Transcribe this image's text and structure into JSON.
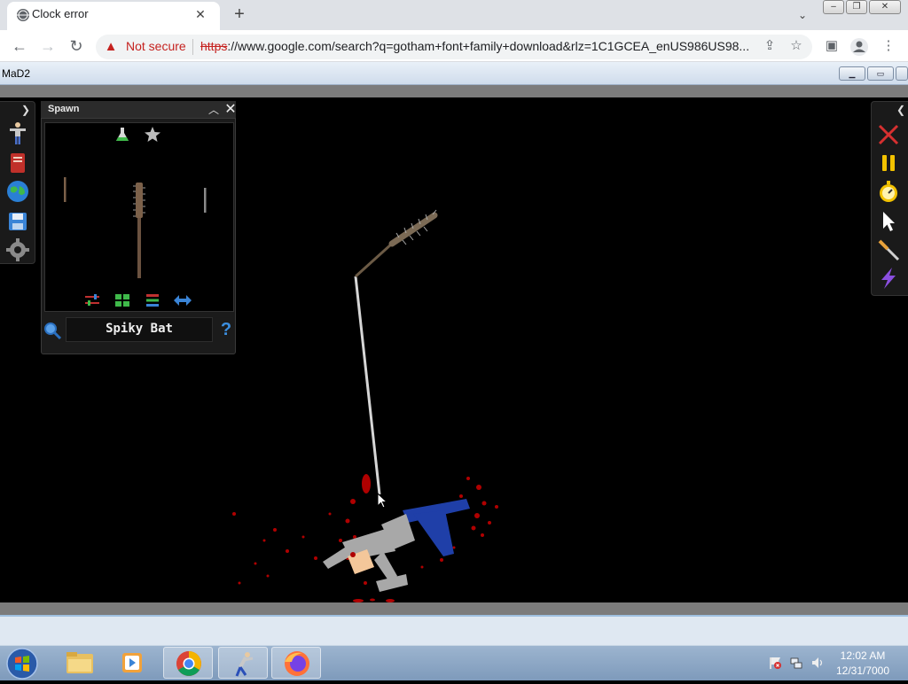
{
  "browser": {
    "tab_title": "Clock error",
    "tab_close": "✕",
    "new_tab": "+",
    "tab_search": "⌄",
    "security_label": "Not secure",
    "url_scheme": "https",
    "url_rest": "://www.google.com/search?q=gotham+font+family+download&rlz=1C1GCEA_enUS986US98...",
    "icons": [
      "back-arrow",
      "forward-arrow",
      "reload",
      "warning-triangle",
      "share",
      "bookmark-star",
      "side-panel",
      "profile",
      "kebab-menu"
    ]
  },
  "app": {
    "title": "MaD2",
    "spawn": {
      "title": "Spawn",
      "item_name": "Spiky Bat",
      "help": "?"
    },
    "left_tools": [
      "ragdoll",
      "book",
      "globe",
      "save",
      "settings"
    ],
    "right_tools": [
      "clear",
      "pause",
      "stopwatch",
      "cursor",
      "knife",
      "lightning"
    ]
  },
  "taskbar": {
    "time": "12:02 AM",
    "date": "12/31/7000",
    "apps": [
      "start",
      "explorer",
      "media-player",
      "chrome",
      "game",
      "firefox"
    ]
  },
  "colors": {
    "warning_red": "#c5221f",
    "blood": "#b00000",
    "ragdoll_grey": "#a8a8a8",
    "ragdoll_blue": "#1f3fa8",
    "skin": "#f4c79a"
  }
}
